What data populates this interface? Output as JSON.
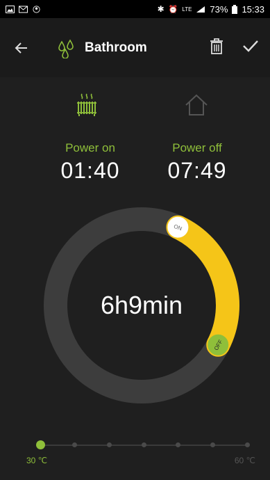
{
  "status": {
    "battery": "73%",
    "time": "15:33",
    "network": "LTE"
  },
  "header": {
    "title": "Bathroom"
  },
  "schedule": {
    "power_on_label": "Power on",
    "power_on_time": "01:40",
    "power_off_label": "Power off",
    "power_off_time": "07:49",
    "duration": "6h9min",
    "on_marker": "ON",
    "off_marker": "OFF"
  },
  "temperature": {
    "min_label": "30 ℃",
    "max_label": "60 ℃",
    "selected_step": 0,
    "steps": 7
  },
  "colors": {
    "accent_green": "#8fbf3a",
    "arc_yellow": "#f5c518",
    "ring_gray": "#3d3d3d",
    "background": "#1f1f1f"
  }
}
